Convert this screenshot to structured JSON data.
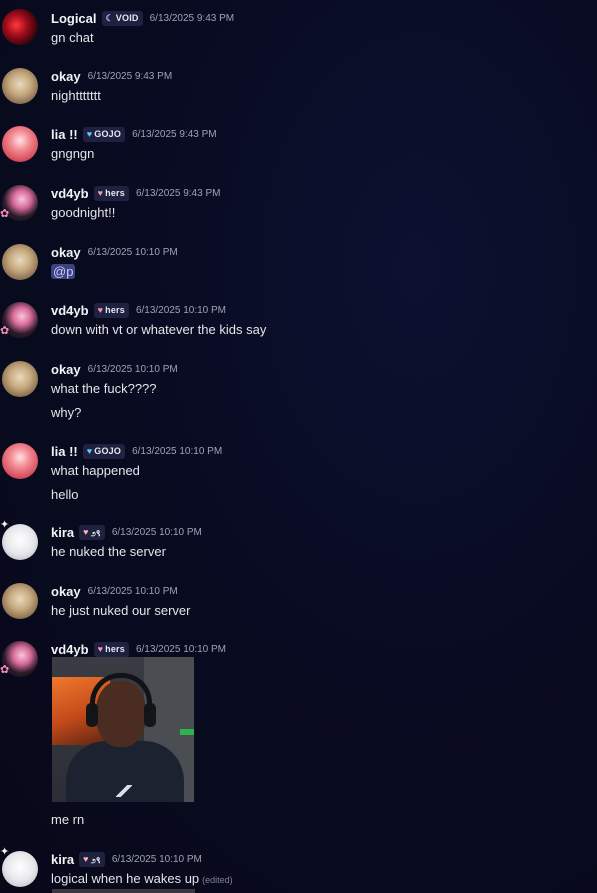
{
  "colors": {
    "background": "#090b22",
    "username": "#f2f3f5",
    "message_text": "#e3e5e8",
    "timestamp": "#9ea3b3",
    "mention_bg": "#3c4280",
    "mention_text": "#c9cdfb"
  },
  "messages": [
    {
      "author": "Logical",
      "tag": "VOID",
      "tag_icon": "☾",
      "time": "6/13/2025 9:43 PM",
      "lines": [
        "gn chat"
      ]
    },
    {
      "author": "okay",
      "time": "6/13/2025 9:43 PM",
      "lines": [
        "nighttttttt"
      ]
    },
    {
      "author": "lia !!",
      "tag": "GOJO",
      "tag_icon": "♥",
      "time": "6/13/2025 9:43 PM",
      "lines": [
        "gngngn"
      ]
    },
    {
      "author": "vd4yb",
      "tag": "hers",
      "tag_icon": "♥",
      "time": "6/13/2025 9:43 PM",
      "lines": [
        "goodnight!!"
      ]
    },
    {
      "author": "okay",
      "time": "6/13/2025 10:10 PM",
      "mention": "@p"
    },
    {
      "author": "vd4yb",
      "tag": "hers",
      "tag_icon": "♥",
      "time": "6/13/2025 10:10 PM",
      "lines": [
        "down with vt or whatever the kids say"
      ]
    },
    {
      "author": "okay",
      "time": "6/13/2025 10:10 PM",
      "lines": [
        "what the fuck????",
        "why?"
      ]
    },
    {
      "author": "lia !!",
      "tag": "GOJO",
      "tag_icon": "♥",
      "time": "6/13/2025 10:10 PM",
      "lines": [
        "what happened",
        "hello"
      ]
    },
    {
      "author": "kira",
      "tag": "೨९",
      "tag_icon": "♥",
      "time": "6/13/2025 10:10 PM",
      "lines": [
        "he nuked the server"
      ]
    },
    {
      "author": "okay",
      "time": "6/13/2025 10:10 PM",
      "lines": [
        "he just nuked our server"
      ]
    },
    {
      "author": "vd4yb",
      "tag": "hers",
      "tag_icon": "♥",
      "time": "6/13/2025 10:10 PM",
      "attachment": "image",
      "lines": [
        "me rn"
      ]
    },
    {
      "author": "kira",
      "tag": "೨९",
      "tag_icon": "♥",
      "time": "6/13/2025 10:10 PM",
      "lines": [
        "logical when he wakes up"
      ],
      "edited": "(edited)"
    }
  ]
}
